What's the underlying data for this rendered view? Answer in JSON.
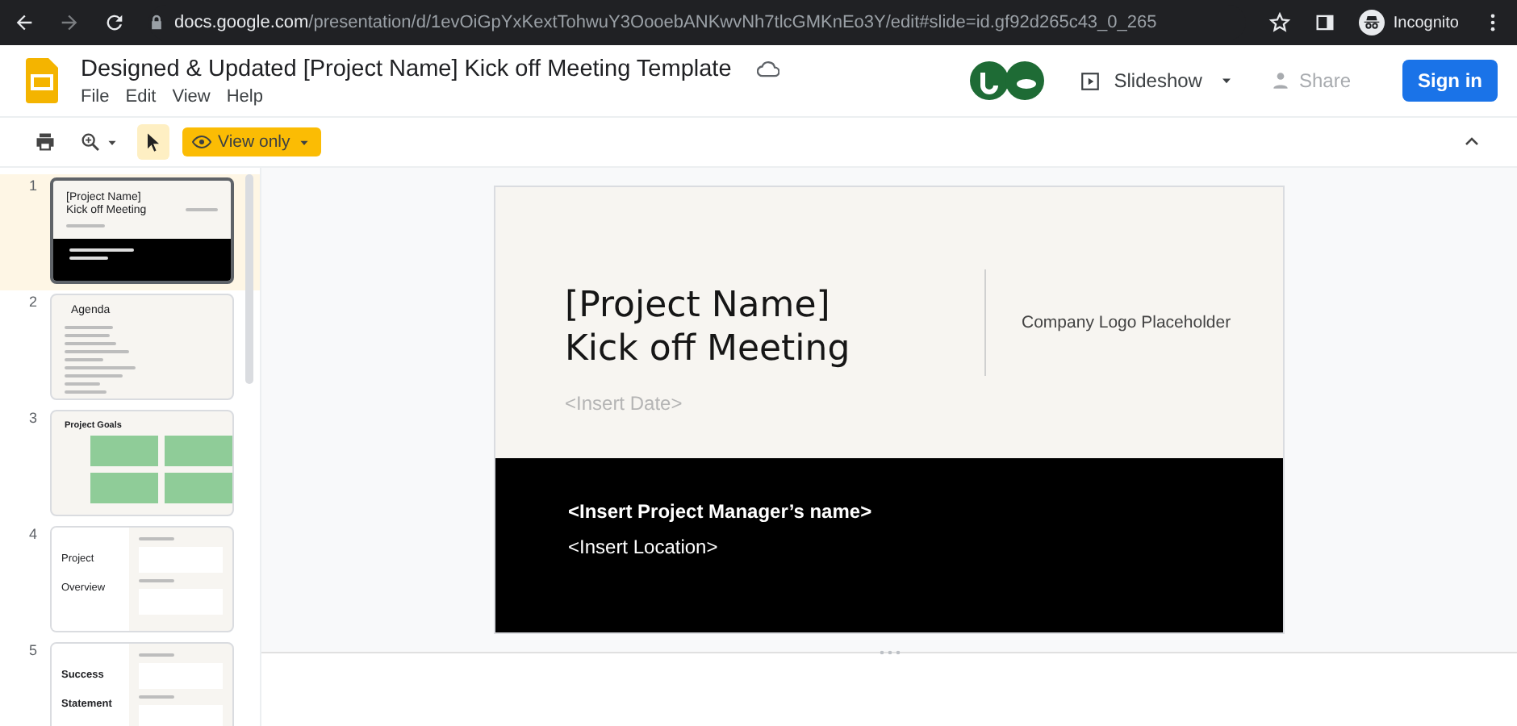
{
  "browser": {
    "url_host": "docs.google.com",
    "url_path": "/presentation/d/1evOiGpYxKextTohwuY3OooebANKwvNh7tlcGMKnEo3Y/edit#slide=id.gf92d265c43_0_265",
    "profile": "Incognito"
  },
  "document": {
    "title": "Designed & Updated [Project Name]  Kick off Meeting Template",
    "menu": [
      "File",
      "Edit",
      "View",
      "Help"
    ]
  },
  "actions": {
    "slideshow": "Slideshow",
    "share": "Share",
    "sign_in": "Sign in"
  },
  "toolbar": {
    "pointer_selected": true,
    "view_only": "View only"
  },
  "filmstrip": [
    {
      "number": "1",
      "kind": "title",
      "title": "[Project Name] Kick off Meeting",
      "selected": true
    },
    {
      "number": "2",
      "kind": "agenda",
      "title": "Agenda",
      "selected": false
    },
    {
      "number": "3",
      "kind": "goals",
      "title": "Project Goals",
      "selected": false
    },
    {
      "number": "4",
      "kind": "overview",
      "title": "Project Overview",
      "selected": false
    },
    {
      "number": "5",
      "kind": "statement",
      "title": "Success Statement",
      "selected": false
    }
  ],
  "slide": {
    "title_lines": [
      "[Project Name]",
      "Kick off Meeting"
    ],
    "date": "<Insert Date>",
    "logo": "Company Logo Placeholder",
    "manager": "<Insert Project Manager’s name>",
    "location": "<Insert Location>"
  }
}
